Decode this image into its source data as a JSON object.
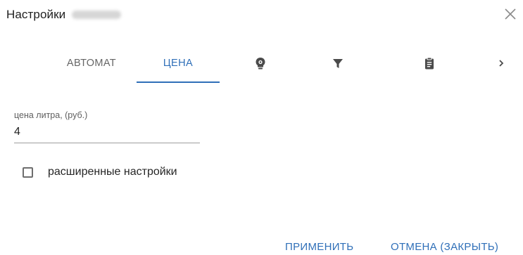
{
  "dialog": {
    "title": "Настройки",
    "close_icon": "close-icon"
  },
  "tabs": [
    {
      "label": "АВТОМАТ",
      "active": false
    },
    {
      "label": "ЦЕНА",
      "active": true
    },
    {
      "icon": "lightbulb-gear-icon",
      "active": false
    },
    {
      "icon": "filter-icon",
      "active": false
    },
    {
      "icon": "clipboard-icon",
      "active": false
    },
    {
      "icon": "chevron-right-icon",
      "active": false
    }
  ],
  "price_field": {
    "label": "цена литра, (руб.)",
    "value": "4"
  },
  "advanced_settings": {
    "label": "расширенные настройки",
    "checked": false
  },
  "actions": {
    "apply_label": "ПРИМЕНИТЬ",
    "cancel_label": "ОТМЕНА (ЗАКРЫТЬ)"
  },
  "colors": {
    "accent": "#2f6fb8",
    "text": "#212121",
    "muted": "#666666",
    "icon": "#4a4a4a"
  }
}
